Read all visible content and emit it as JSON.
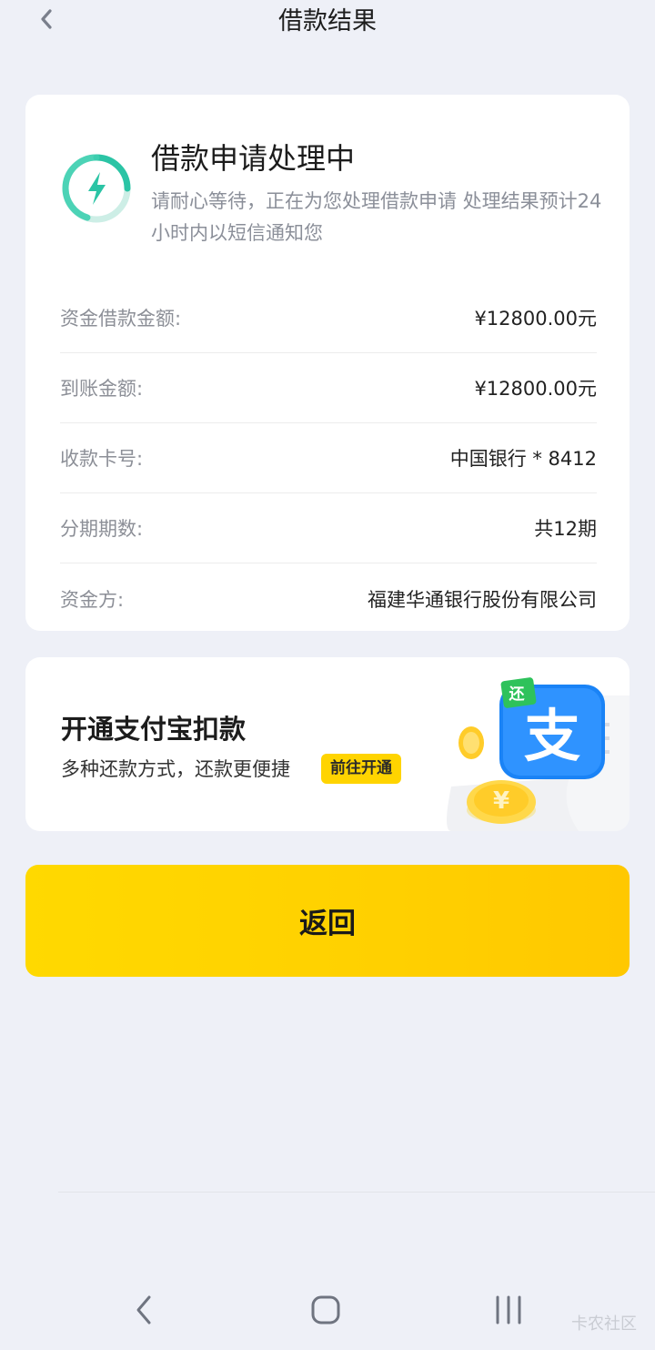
{
  "header": {
    "title": "借款结果",
    "back_icon": "chevron-left-icon"
  },
  "status": {
    "title": "借款申请处理中",
    "description": "请耐心等待，正在为您处理借款申请 处理结果预计24小时内以短信通知您",
    "icon": "lightning-progress-icon",
    "accent_color": "#2bc4a5"
  },
  "details": [
    {
      "label": "资金借款金额:",
      "value": "¥12800.00元"
    },
    {
      "label": "到账金额:",
      "value": "¥12800.00元"
    },
    {
      "label": "收款卡号:",
      "value": "中国银行 * 8412"
    },
    {
      "label": "分期期数:",
      "value": "共12期"
    },
    {
      "label": "资金方:",
      "value": "福建华通银行股份有限公司"
    }
  ],
  "promo": {
    "title": "开通支付宝扣款",
    "subtitle": "多种还款方式，还款更便捷",
    "button_label": "前往开通",
    "art_glyph": "支",
    "art_tag": "还",
    "art_coin": "¥"
  },
  "actions": {
    "return_label": "返回"
  },
  "system_nav": {
    "back_icon": "nav-back-icon",
    "home_icon": "nav-home-icon",
    "recent_icon": "nav-recents-icon"
  },
  "watermark": "卡农社区"
}
